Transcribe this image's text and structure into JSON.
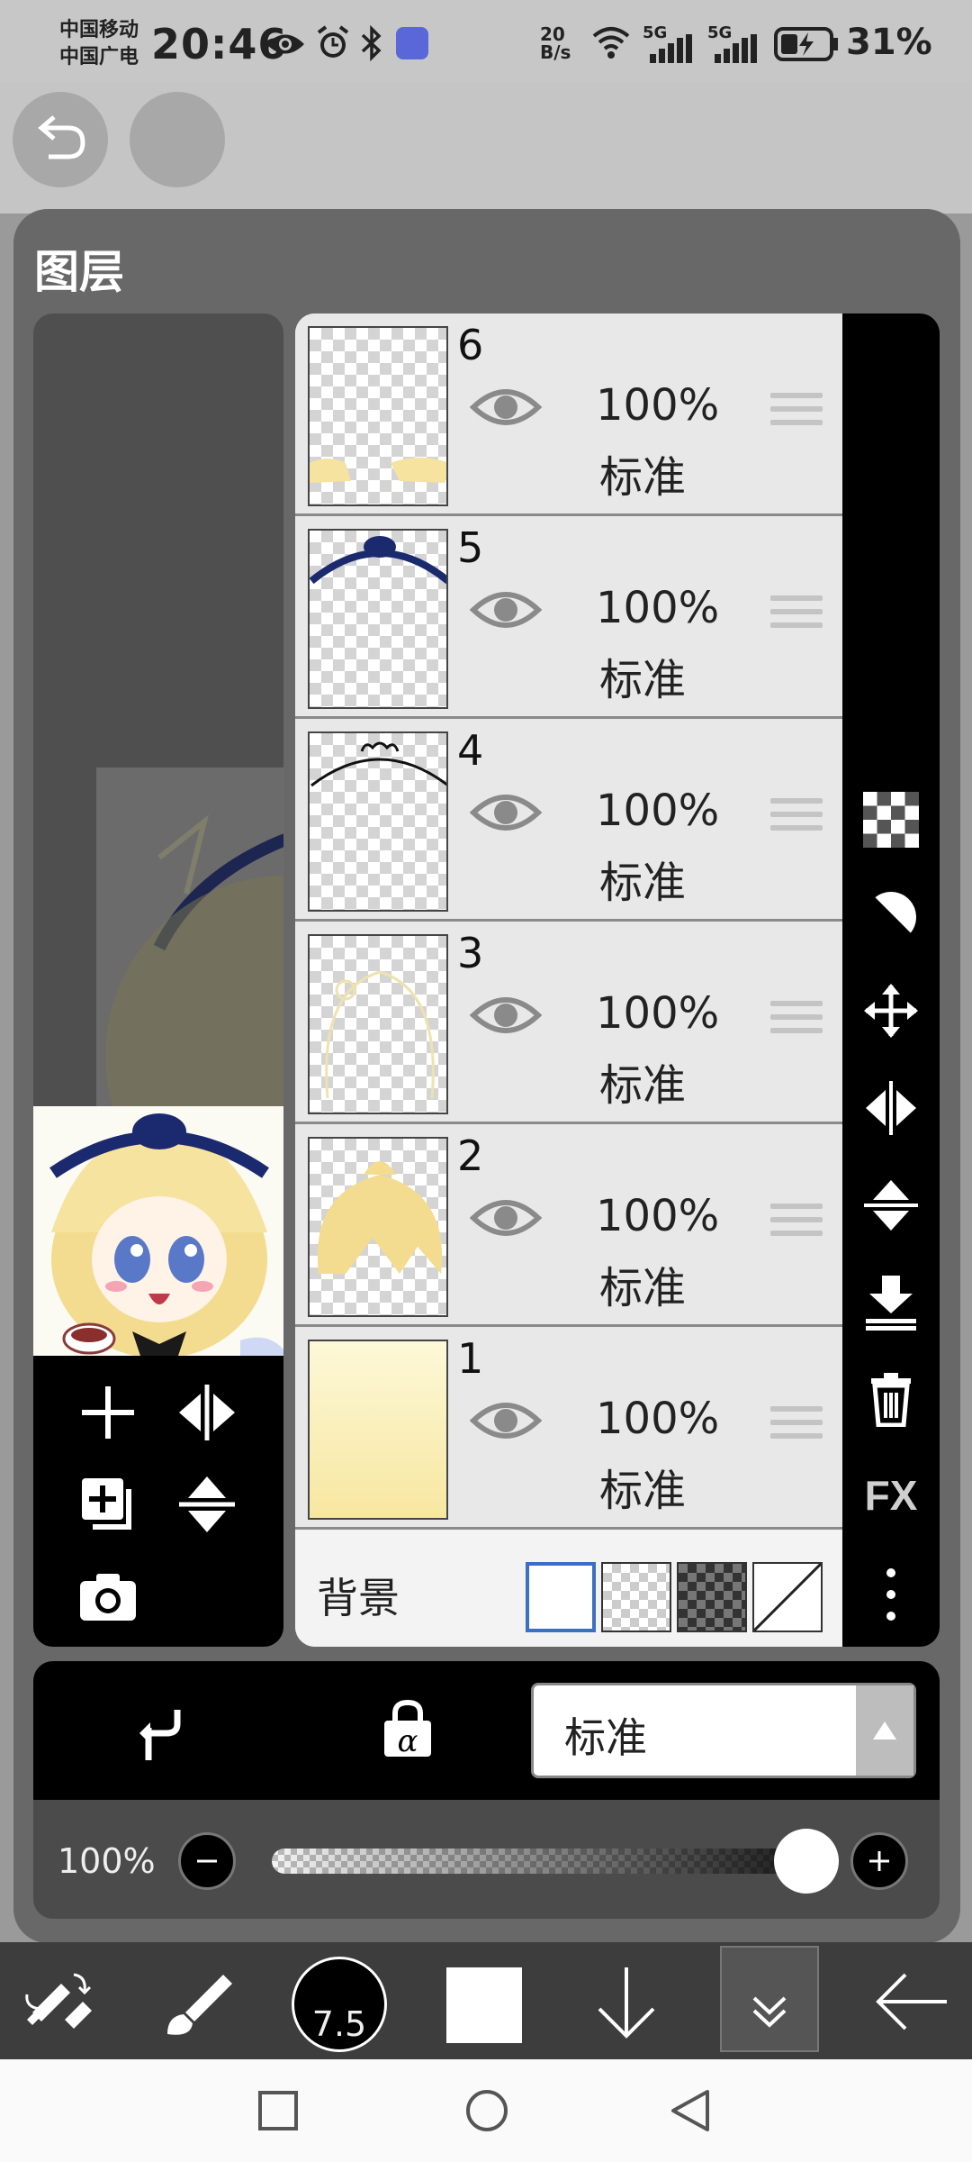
{
  "status_bar": {
    "carrier1": "中国移动",
    "carrier2": "中国广电",
    "time": "20:46",
    "net_speed_value": "20",
    "net_speed_unit": "B/s",
    "net1": "5G",
    "net2": "5G",
    "battery": "31%"
  },
  "panel": {
    "title": "图层"
  },
  "layers": [
    {
      "number": "6",
      "opacity": "100%",
      "mode": "标准"
    },
    {
      "number": "5",
      "opacity": "100%",
      "mode": "标准"
    },
    {
      "number": "4",
      "opacity": "100%",
      "mode": "标准"
    },
    {
      "number": "3",
      "opacity": "100%",
      "mode": "标准"
    },
    {
      "number": "2",
      "opacity": "100%",
      "mode": "标准"
    },
    {
      "number": "1",
      "opacity": "100%",
      "mode": "标准"
    }
  ],
  "background_row": {
    "label": "背景"
  },
  "right_toolbar": {
    "fx_label": "FX"
  },
  "blend": {
    "mode": "标准"
  },
  "opacity_control": {
    "label": "100%",
    "value": 1.0
  },
  "bottom_toolbar": {
    "brush_size": "7.5"
  },
  "colors": {
    "panel": "#686868",
    "list_row": "#e8e8e8",
    "toolbar": "#000000",
    "accent_selected": "#3a6fc4"
  }
}
